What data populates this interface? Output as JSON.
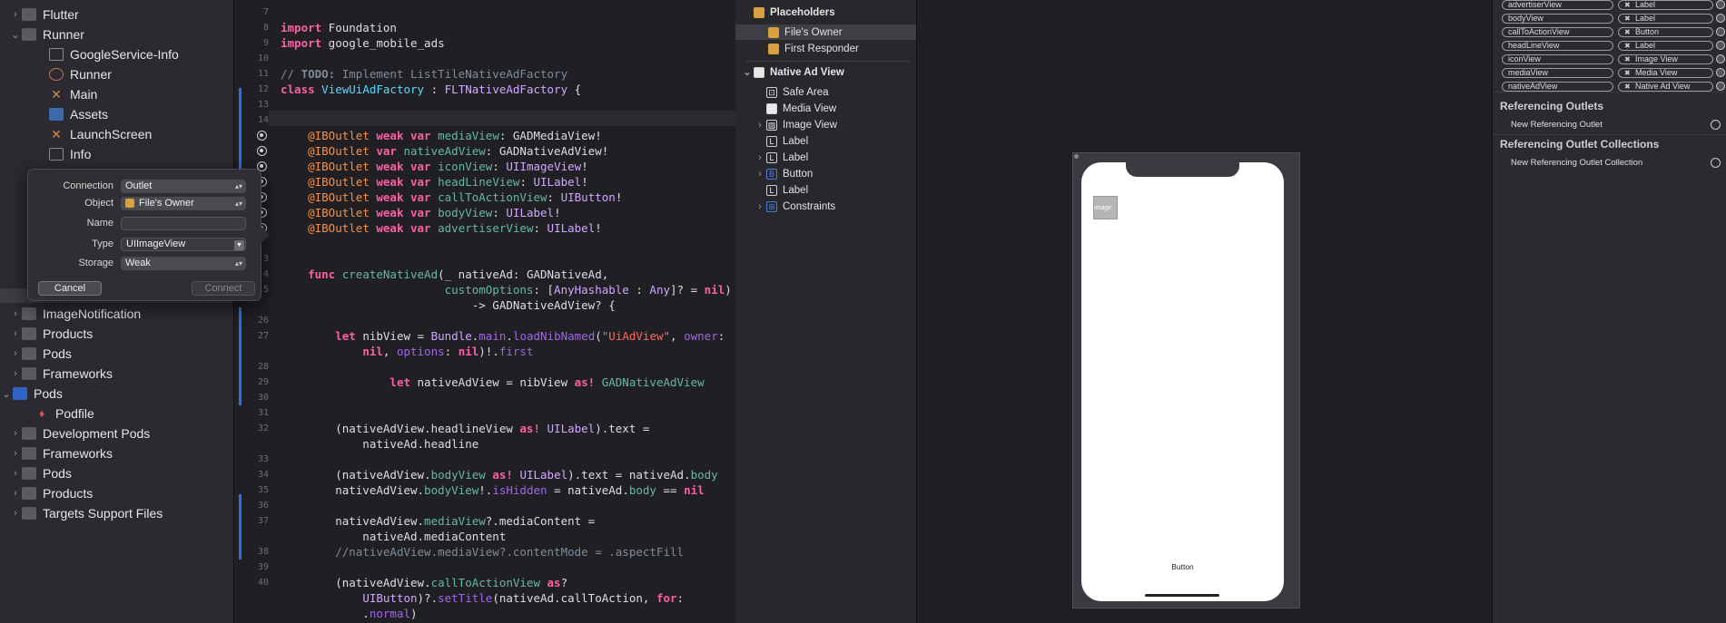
{
  "navigator": {
    "items": [
      {
        "label": "Flutter",
        "chevron": "›",
        "icon": "folder"
      },
      {
        "label": "Runner",
        "chevron": "⌄",
        "icon": "folder"
      },
      {
        "label": "GoogleService-Info",
        "chevron": "",
        "icon": "table"
      },
      {
        "label": "Runner",
        "chevron": "",
        "icon": "circle"
      },
      {
        "label": "Main",
        "chevron": "",
        "icon": "xib"
      },
      {
        "label": "Assets",
        "chevron": "",
        "icon": "asset"
      },
      {
        "label": "LaunchScreen",
        "chevron": "",
        "icon": "xib"
      },
      {
        "label": "Info",
        "chevron": "",
        "icon": "table"
      },
      {
        "label": "ImageNotification",
        "chevron": "›",
        "icon": "folder"
      },
      {
        "label": "Products",
        "chevron": "›",
        "icon": "folder"
      },
      {
        "label": "Pods",
        "chevron": "›",
        "icon": "folder"
      },
      {
        "label": "Frameworks",
        "chevron": "›",
        "icon": "folder"
      },
      {
        "label": "Pods",
        "chevron": "⌄",
        "icon": "pods"
      },
      {
        "label": "Podfile",
        "chevron": "",
        "icon": "gem"
      },
      {
        "label": "Development Pods",
        "chevron": "›",
        "icon": "folder"
      },
      {
        "label": "Frameworks",
        "chevron": "›",
        "icon": "folder"
      },
      {
        "label": "Pods",
        "chevron": "›",
        "icon": "folder"
      },
      {
        "label": "Products",
        "chevron": "›",
        "icon": "folder"
      },
      {
        "label": "Targets Support Files",
        "chevron": "›",
        "icon": "folder"
      }
    ]
  },
  "popover": {
    "connection_label": "Connection",
    "connection_value": "Outlet",
    "object_label": "Object",
    "object_value": "File's Owner",
    "name_label": "Name",
    "name_value": "",
    "type_label": "Type",
    "type_value": "UIImageView",
    "storage_label": "Storage",
    "storage_value": "Weak",
    "cancel": "Cancel",
    "connect": "Connect"
  },
  "editor": {
    "lines": [
      {
        "n": "7",
        "html": ""
      },
      {
        "n": "8",
        "html": "<span class=\"kw\">import</span> Foundation"
      },
      {
        "n": "9",
        "html": "<span class=\"kw\">import</span> google_mobile_ads"
      },
      {
        "n": "10",
        "html": ""
      },
      {
        "n": "11",
        "html": "<span class=\"cm\">// </span><span class=\"cmb\">TODO:</span><span class=\"cm\"> Implement ListTileNativeAdFactory</span>"
      },
      {
        "n": "12",
        "html": "<span class=\"kw\">class</span> <span class=\"ty2\">ViewUiAdFactory</span> : <span class=\"ty\">FLTNativeAdFactory</span> {"
      },
      {
        "n": "13",
        "html": ""
      },
      {
        "n": "14",
        "html": ""
      },
      {
        "n": "",
        "html": "    <span class=\"at\">@IBOutlet</span> <span class=\"kw\">weak var</span> <span class=\"pr\">mediaView</span>: GADMediaView!",
        "dot": true
      },
      {
        "n": "",
        "html": "    <span class=\"at\">@IBOutlet</span> <span class=\"kw\">var</span> <span class=\"pr\">nativeAdView</span>: GADNativeAdView!",
        "dot": true
      },
      {
        "n": "",
        "html": "    <span class=\"at\">@IBOutlet</span> <span class=\"kw\">weak var</span> <span class=\"pr\">iconView</span>: <span class=\"ty\">UIImageView</span>!",
        "dot": true
      },
      {
        "n": "",
        "html": "    <span class=\"at\">@IBOutlet</span> <span class=\"kw\">weak var</span> <span class=\"pr\">headLineView</span>: <span class=\"ty\">UILabel</span>!",
        "dot": true
      },
      {
        "n": "",
        "html": "    <span class=\"at\">@IBOutlet</span> <span class=\"kw\">weak var</span> <span class=\"pr\">callToActionView</span>: <span class=\"ty\">UIButton</span>!",
        "dot": true
      },
      {
        "n": "",
        "html": "    <span class=\"at\">@IBOutlet</span> <span class=\"kw\">weak var</span> <span class=\"pr\">bodyView</span>: <span class=\"ty\">UILabel</span>!",
        "dot": true
      },
      {
        "n": "",
        "html": "    <span class=\"at\">@IBOutlet</span> <span class=\"kw\">weak var</span> <span class=\"pr\">advertiserView</span>: <span class=\"ty\">UILabel</span>!",
        "dot": true
      },
      {
        "n": "",
        "html": ""
      },
      {
        "n": "3",
        "html": ""
      },
      {
        "n": "4",
        "html": "    <span class=\"kw\">func</span> <span class=\"fn\">createNativeAd</span>(_ nativeAd: GADNativeAd,"
      },
      {
        "n": "5",
        "html": "                        <span class=\"pr\">customOptions</span>: [<span class=\"ty\">AnyHashable</span> : <span class=\"ty\">Any</span>]? = <span class=\"kw\">nil</span>)"
      },
      {
        "n": "",
        "html": "                            -&gt; GADNativeAdView? {"
      },
      {
        "n": "26",
        "html": ""
      },
      {
        "n": "27",
        "html": "        <span class=\"kw\">let</span> nibView = <span class=\"ty\">Bundle</span>.<span class=\"mem\">main</span>.<span class=\"mem\">loadNibNamed</span>(<span class=\"st\">\"UiAdView\"</span>, <span class=\"mem\">owner</span>:"
      },
      {
        "n": "",
        "html": "            <span class=\"kw\">nil</span>, <span class=\"mem\">options</span>: <span class=\"kw\">nil</span>)!.<span class=\"mem\">first</span>"
      },
      {
        "n": "28",
        "html": ""
      },
      {
        "n": "29",
        "html": "                <span class=\"kw\">let</span> nativeAdView = nibView <span class=\"kw\">as!</span> <span class=\"pr\">GADNativeAdView</span>"
      },
      {
        "n": "30",
        "html": ""
      },
      {
        "n": "31",
        "html": ""
      },
      {
        "n": "32",
        "html": "        (nativeAdView.headlineView <span class=\"kw\">as!</span> <span class=\"ty\">UILabel</span>).text ="
      },
      {
        "n": "",
        "html": "            nativeAd.headline"
      },
      {
        "n": "33",
        "html": ""
      },
      {
        "n": "34",
        "html": "        (nativeAdView.<span class=\"pr\">bodyView</span> <span class=\"kw\">as!</span> <span class=\"ty\">UILabel</span>).text = nativeAd.<span class=\"pr\">body</span>"
      },
      {
        "n": "35",
        "html": "        nativeAdView.<span class=\"pr\">bodyView</span>!.<span class=\"mem\">isHidden</span> = nativeAd.<span class=\"pr\">body</span> == <span class=\"kw\">nil</span>"
      },
      {
        "n": "36",
        "html": ""
      },
      {
        "n": "37",
        "html": "        nativeAdView.<span class=\"pr\">mediaView</span>?.mediaContent ="
      },
      {
        "n": "",
        "html": "            nativeAd.mediaContent"
      },
      {
        "n": "38",
        "html": "        <span class=\"cm\">//nativeAdView.mediaView?.contentMode = .aspectFill</span>"
      },
      {
        "n": "39",
        "html": ""
      },
      {
        "n": "40",
        "html": "        (nativeAdView.<span class=\"pr\">callToActionView</span> <span class=\"kw\">as</span>?"
      },
      {
        "n": "",
        "html": "            <span class=\"ty\">UIButton</span>)?.<span class=\"mem\">setTitle</span>(nativeAd.callToAction, <span class=\"kw\">for</span>:"
      },
      {
        "n": "",
        "html": "            .<span class=\"mem\">normal</span>)"
      }
    ]
  },
  "outline": {
    "placeholders_title": "Placeholders",
    "files_owner": "File's Owner",
    "first_responder": "First Responder",
    "native_ad_view": "Native Ad View",
    "children": [
      {
        "label": "Safe Area",
        "icon_text": "⊡",
        "chevron": ""
      },
      {
        "label": "Media View",
        "icon_text": "",
        "chevron": ""
      },
      {
        "label": "Image View",
        "icon_text": "▨",
        "chevron": "›"
      },
      {
        "label": "Label",
        "icon_text": "L",
        "chevron": ""
      },
      {
        "label": "Label",
        "icon_text": "L",
        "chevron": "›"
      },
      {
        "label": "Button",
        "icon_text": "B",
        "chevron": "›"
      },
      {
        "label": "Label",
        "icon_text": "L",
        "chevron": ""
      },
      {
        "label": "Constraints",
        "icon_text": "⊞",
        "chevron": "›"
      }
    ]
  },
  "canvas": {
    "image_placeholder": "image",
    "button_label": "Button"
  },
  "inspector": {
    "outlets": [
      {
        "name": "advertiserView",
        "target": "Label"
      },
      {
        "name": "bodyView",
        "target": "Label"
      },
      {
        "name": "callToActionView",
        "target": "Button"
      },
      {
        "name": "headLineView",
        "target": "Label"
      },
      {
        "name": "iconView",
        "target": "Image View"
      },
      {
        "name": "mediaView",
        "target": "Media View"
      },
      {
        "name": "nativeAdView",
        "target": "Native Ad View"
      }
    ],
    "referencing_outlets_title": "Referencing Outlets",
    "new_referencing_outlet": "New Referencing Outlet",
    "referencing_outlet_collections_title": "Referencing Outlet Collections",
    "new_referencing_outlet_collection": "New Referencing Outlet Collection"
  }
}
